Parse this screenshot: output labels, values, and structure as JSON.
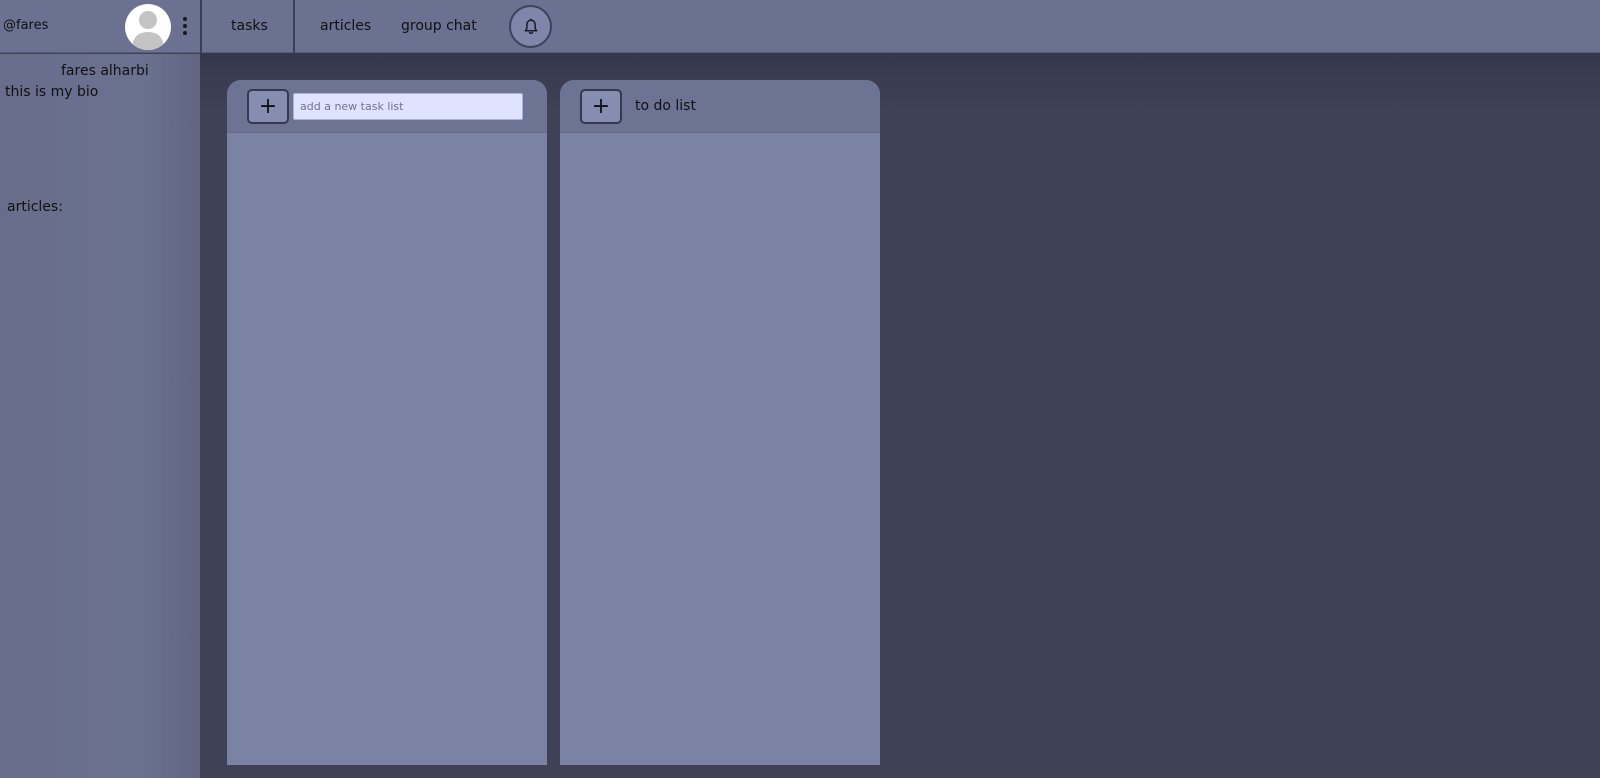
{
  "header": {
    "username": "@fares",
    "nav": {
      "tasks": "tasks",
      "articles": "articles",
      "group_chat": "group chat"
    }
  },
  "sidebar": {
    "full_name": "fares alharbi",
    "bio": "this is my bio",
    "articles_label": "articles:"
  },
  "task_panels": {
    "new_list": {
      "add_label": "+",
      "input_value": "",
      "input_placeholder": "add a new task list"
    },
    "todo_list": {
      "add_label": "+",
      "title": "to do list"
    }
  },
  "icons": {
    "avatar": "avatar-icon",
    "menu": "more-vertical-icon",
    "notifications": "bell-icon"
  },
  "colors": {
    "background": "#3f4157",
    "bar": "#6b7190",
    "panel": "#7a83a3",
    "input": "#dfe3ff"
  }
}
